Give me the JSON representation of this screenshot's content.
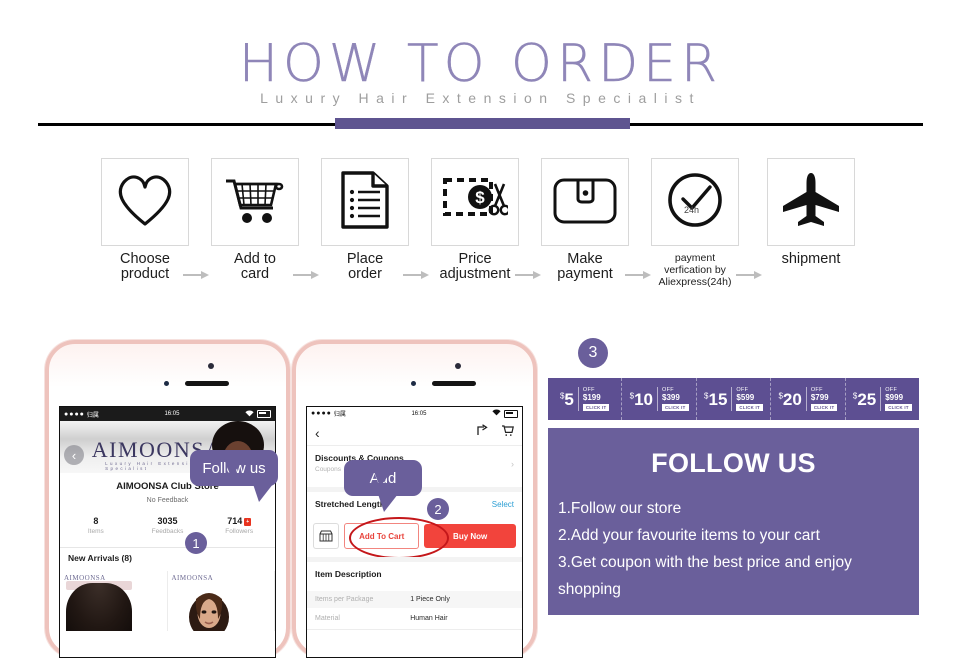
{
  "header": {
    "title": "HOW TO ORDER",
    "subtitle": "Luxury Hair Extension Specialist"
  },
  "steps": [
    {
      "icon": "heart-icon",
      "label_line1": "Choose",
      "label_line2": "product"
    },
    {
      "icon": "shopping-cart-icon",
      "label_line1": "Add to",
      "label_line2": "card"
    },
    {
      "icon": "document-icon",
      "label_line1": "Place",
      "label_line2": "order"
    },
    {
      "icon": "coupon-scissors-icon",
      "label_line1": "Price",
      "label_line2": "adjustment"
    },
    {
      "icon": "wallet-icon",
      "label_line1": "Make",
      "label_line2": "payment"
    },
    {
      "icon": "clock-check-icon",
      "label_line1": "payment",
      "label_line2": "verfication by",
      "label_line3": "Aliexpress(24h)",
      "icon_text": "24h"
    },
    {
      "icon": "airplane-icon",
      "label_line1": "shipment",
      "label_line2": ""
    }
  ],
  "phone1": {
    "statusbar": {
      "dots": "●●●●",
      "carrier": "归属",
      "time": "16:05"
    },
    "banner_logo": "AIMOONSA",
    "banner_sub": "Luxury Hair Extension Specialist",
    "store_name": "AIMOONSA Club Store",
    "feedback_note": "No Feedback",
    "stats": [
      {
        "value": "8",
        "label": "Items",
        "badge": ""
      },
      {
        "value": "3035",
        "label": "Feedbacks",
        "badge": ""
      },
      {
        "value": "714",
        "label": "Followers",
        "badge": "+"
      }
    ],
    "new_arrivals": "New Arrivals (8)",
    "thumb_watermark": "AIMOONSA",
    "bubble": "Follow us",
    "badge": "1"
  },
  "phone2": {
    "statusbar": {
      "dots": "●●●●",
      "carrier": "归属",
      "time": "16:05"
    },
    "coupons_title": "Discounts & Coupons",
    "coupons_sub": "Coupons",
    "length_title": "Stretched Length",
    "select_label": "Select",
    "add_to_cart": "Add To Cart",
    "buy_now": "Buy Now",
    "item_description": "Item Description",
    "description_rows": [
      {
        "key": "Items per Package",
        "value": "1 Piece Only"
      },
      {
        "key": "Material",
        "value": "Human Hair"
      }
    ],
    "bubble": "Add",
    "badge": "2"
  },
  "right": {
    "badge": "3",
    "coupons": [
      {
        "amount": "5",
        "currency": "$",
        "off": "OFF",
        "threshold": "$199",
        "button": "CLICK IT"
      },
      {
        "amount": "10",
        "currency": "$",
        "off": "OFF",
        "threshold": "$399",
        "button": "CLICK IT"
      },
      {
        "amount": "15",
        "currency": "$",
        "off": "OFF",
        "threshold": "$599",
        "button": "CLICK IT"
      },
      {
        "amount": "20",
        "currency": "$",
        "off": "OFF",
        "threshold": "$799",
        "button": "CLICK IT"
      },
      {
        "amount": "25",
        "currency": "$",
        "off": "OFF",
        "threshold": "$999",
        "button": "CLICK IT"
      }
    ],
    "follow_title": "FOLLOW US",
    "follow_items": [
      "1.Follow our store",
      "2.Add your favourite items to your cart",
      "3.Get coupon with the best price and enjoy",
      "shopping"
    ]
  },
  "colors": {
    "purple": "#6a5f9b",
    "purple_dark": "#5d4f92",
    "title_purple": "#8f86b8",
    "red": "#f2443c",
    "red_outline": "#c4171a",
    "phone_frame": "#eec3bd"
  }
}
